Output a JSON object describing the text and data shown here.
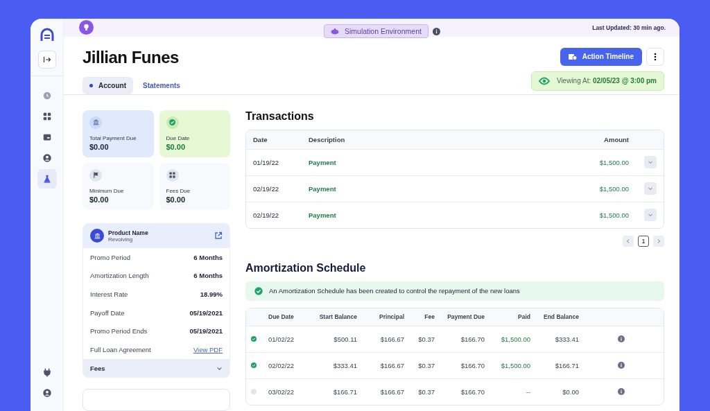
{
  "sidebar": {
    "items": [
      {
        "selected": false
      },
      {
        "selected": false
      },
      {
        "selected": false
      },
      {
        "selected": false
      },
      {
        "selected": true
      }
    ],
    "bottom_items": [
      {
        "selected": false
      },
      {
        "selected": false
      }
    ]
  },
  "topbar": {
    "environment": "Simulation Environment",
    "last_updated": "Last Updated: 30 min ago."
  },
  "header": {
    "title": "Jillian Funes",
    "action_button": "Action Timeline",
    "viewing": "Viewing At: **02/05/23 @ 3:00 pm**",
    "tabs": [
      {
        "label": "Account",
        "selected": true
      },
      {
        "label": "Statements",
        "selected": false
      }
    ]
  },
  "summary_cards": [
    {
      "label": "Total Payment Due",
      "value": "$0.00"
    },
    {
      "label": "Due Date",
      "value": "$0.00"
    },
    {
      "label": "Minimum Due",
      "value": "$0.00"
    },
    {
      "label": "Fees Due",
      "value": "$0.00"
    }
  ],
  "product": {
    "name": "Product Name",
    "type": "Revolving",
    "rows": [
      {
        "label": "Promo Period",
        "value": "6 Months",
        "kind": "text"
      },
      {
        "label": "Amortization Length",
        "value": "6 Months",
        "kind": "text"
      },
      {
        "label": "Interest Rate",
        "value": "18.99%",
        "kind": "text"
      },
      {
        "label": "Payoff Date",
        "value": "05/19/2021",
        "kind": "text"
      },
      {
        "label": "Promo Period Ends",
        "value": "05/19/2021",
        "kind": "text"
      },
      {
        "label": "Full Loan Agreement",
        "value": "View PDF",
        "kind": "link"
      }
    ],
    "fees": {
      "label": "Fees",
      "expanded": false
    }
  },
  "transactions": {
    "title": "Transactions",
    "columns": [
      "Date",
      "Description",
      "Amount"
    ],
    "rows": [
      {
        "date": "01/19/22",
        "description": "Payment",
        "amount": "$1,500.00"
      },
      {
        "date": "02/19/22",
        "description": "Payment",
        "amount": "$1,500.00"
      },
      {
        "date": "02/19/22",
        "description": "Payment",
        "amount": "$1,500.00"
      }
    ],
    "page": "1"
  },
  "amortization": {
    "title": "Amortization Schedule",
    "banner": "An Amortization Schedule has been created to control the repayment of the new loans",
    "columns": [
      "Due Date",
      "Start Balance",
      "Principal",
      "Fee",
      "Payment Due",
      "Paid",
      "End Balance"
    ],
    "rows": [
      {
        "paid": true,
        "cells": [
          "01/02/22",
          "$500.11",
          "$166.67",
          "$0.37",
          "$166.70",
          "$1,500.00",
          "$333.41"
        ]
      },
      {
        "paid": true,
        "cells": [
          "02/02/22",
          "$333.41",
          "$166.67",
          "$0.37",
          "$166.70",
          "$1,500.00",
          "$166.71"
        ]
      },
      {
        "paid": false,
        "cells": [
          "03/02/22",
          "$166.71",
          "$166.67",
          "$0.37",
          "$166.70",
          "--",
          "$0.00"
        ]
      }
    ]
  }
}
